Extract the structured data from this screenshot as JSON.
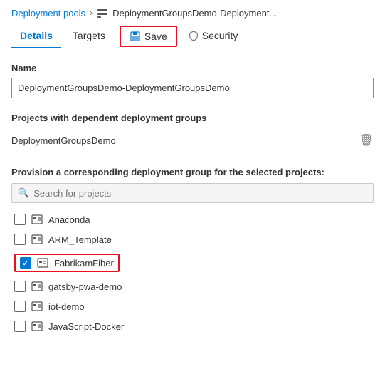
{
  "breadcrumb": {
    "parent": "Deployment pools",
    "current": "DeploymentGroupsDemo-Deployment...",
    "icon": "deployment-icon"
  },
  "tabs": [
    {
      "id": "details",
      "label": "Details",
      "active": true
    },
    {
      "id": "targets",
      "label": "Targets",
      "active": false
    },
    {
      "id": "save",
      "label": "Save",
      "isSaveBtn": true
    },
    {
      "id": "security",
      "label": "Security",
      "active": false
    }
  ],
  "save_label": "Save",
  "security_label": "Security",
  "details_label": "Details",
  "targets_label": "Targets",
  "name_label": "Name",
  "name_value": "DeploymentGroupsDemo-DeploymentGroupsDemo",
  "dependent_section_title": "Projects with dependent deployment groups",
  "dependent_project": "DeploymentGroupsDemo",
  "provision_label": "Provision a corresponding deployment group for the selected projects:",
  "search_placeholder": "Search for projects",
  "projects": [
    {
      "name": "Anaconda",
      "checked": false,
      "highlighted": false
    },
    {
      "name": "ARM_Template",
      "checked": false,
      "highlighted": false
    },
    {
      "name": "FabrikamFiber",
      "checked": true,
      "highlighted": true
    },
    {
      "name": "gatsby-pwa-demo",
      "checked": false,
      "highlighted": false
    },
    {
      "name": "iot-demo",
      "checked": false,
      "highlighted": false
    },
    {
      "name": "JavaScript-Docker",
      "checked": false,
      "highlighted": false
    }
  ]
}
